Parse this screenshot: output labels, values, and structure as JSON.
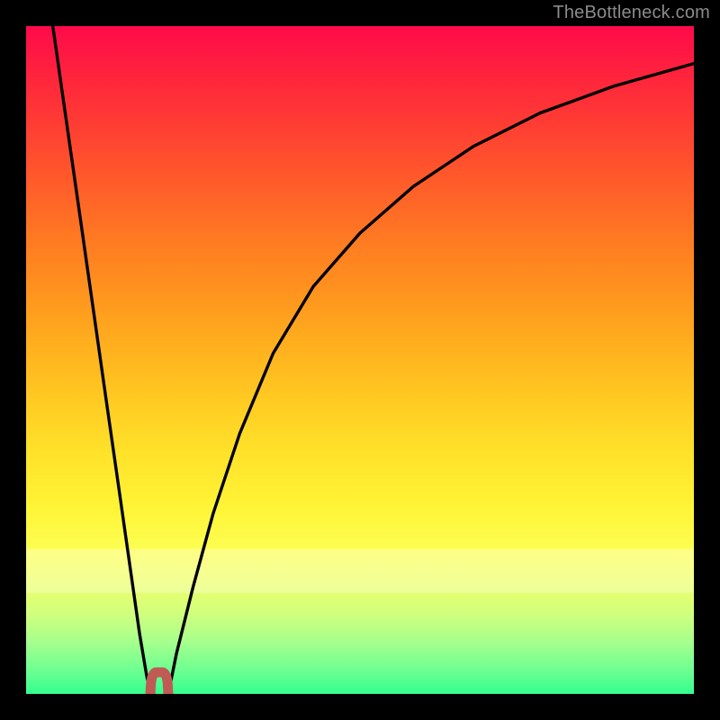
{
  "watermark": "TheBottleneck.com",
  "chart_data": {
    "type": "line",
    "title": "",
    "xlabel": "",
    "ylabel": "",
    "xlim": [
      0,
      1
    ],
    "ylim": [
      0,
      1
    ],
    "series": [
      {
        "name": "left-branch",
        "x": [
          0.04,
          0.06,
          0.08,
          0.1,
          0.12,
          0.14,
          0.16,
          0.17,
          0.18,
          0.186
        ],
        "y": [
          1.0,
          0.86,
          0.72,
          0.58,
          0.44,
          0.3,
          0.16,
          0.09,
          0.03,
          0.0
        ]
      },
      {
        "name": "right-branch",
        "x": [
          0.213,
          0.225,
          0.25,
          0.28,
          0.32,
          0.37,
          0.43,
          0.5,
          0.58,
          0.67,
          0.77,
          0.88,
          1.0
        ],
        "y": [
          0.0,
          0.06,
          0.16,
          0.27,
          0.39,
          0.51,
          0.61,
          0.69,
          0.76,
          0.82,
          0.87,
          0.91,
          0.944
        ]
      },
      {
        "name": "trough-marker",
        "x": [
          0.186,
          0.19,
          0.2,
          0.21,
          0.213
        ],
        "y": [
          0.0,
          0.025,
          0.033,
          0.025,
          0.0
        ]
      }
    ],
    "marker_color": "#c05a55",
    "curve_color": "#000000"
  }
}
